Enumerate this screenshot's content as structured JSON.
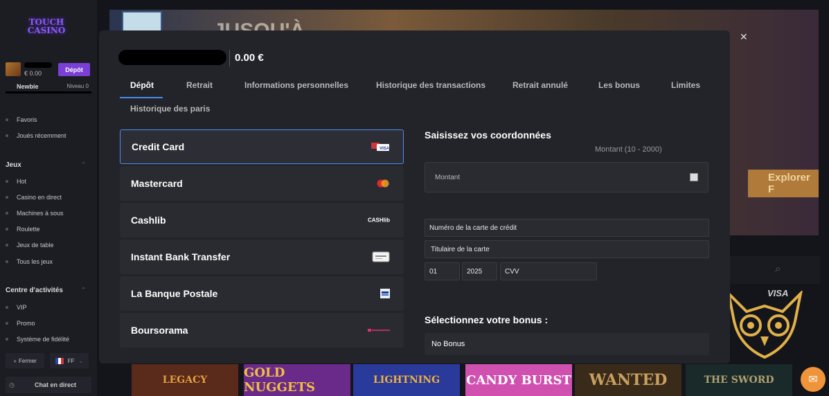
{
  "sidebar": {
    "logo_line1": "TOUCH",
    "logo_line2": "CASINO",
    "balance": "€ 0.00",
    "deposit_label": "Dépôt",
    "level_name": "Newbie",
    "level_label": "Niveau 0",
    "level_progress": 0,
    "items_top": [
      {
        "label": "Favoris"
      },
      {
        "label": "Joués récemment"
      }
    ],
    "jeux_heading": "Jeux",
    "jeux_items": [
      {
        "label": "Hot"
      },
      {
        "label": "Casino en direct"
      },
      {
        "label": "Machines à sous"
      },
      {
        "label": "Roulette"
      },
      {
        "label": "Jeux de table"
      },
      {
        "label": "Tous les jeux"
      }
    ],
    "activity_heading": "Centre d'activités",
    "activity_items": [
      {
        "label": "VIP"
      },
      {
        "label": "Promo"
      },
      {
        "label": "Système de fidélité"
      }
    ],
    "close_label": "Fermer",
    "lang_label": "FF",
    "chat_label": "Chat en direct"
  },
  "background": {
    "banner_text": "JUSQU'À",
    "explorer_label": "Explorer F",
    "visa_text": "VISA",
    "games": [
      "LEGACY",
      "GOLD NUGGETS",
      "LIGHTNING",
      "CANDY BURST",
      "WANTED",
      "THE SWORD"
    ]
  },
  "modal": {
    "balance": "0.00 €",
    "tabs": [
      {
        "label": "Dépôt",
        "active": true
      },
      {
        "label": "Retrait"
      },
      {
        "label": "Informations personnelles"
      },
      {
        "label": "Historique des transactions"
      },
      {
        "label": "Retrait annulé"
      },
      {
        "label": "Les bonus"
      },
      {
        "label": "Limites"
      },
      {
        "label": "Historique des paris"
      }
    ],
    "methods": [
      {
        "label": "Credit Card",
        "logo": "visa-mastercard-logo",
        "selected": true
      },
      {
        "label": "Mastercard",
        "logo": "mastercard-logo"
      },
      {
        "label": "Cashlib",
        "logo": "cashlib-logo",
        "logo_text": "CASHlib"
      },
      {
        "label": "Instant Bank Transfer",
        "logo": "bank-transfer-logo"
      },
      {
        "label": "La Banque Postale",
        "logo": "banque-postale-logo"
      },
      {
        "label": "Boursorama",
        "logo": "boursorama-logo"
      }
    ],
    "form": {
      "title": "Saisissez vos coordonnées",
      "amount_range": "Montant (10 - 2000)",
      "amount_placeholder": "Montant",
      "card_number_placeholder": "Numéro de la carte de crédit",
      "card_holder_placeholder": "Titulaire de la carte",
      "month": "01",
      "year": "2025",
      "cvv_placeholder": "CVV",
      "bonus_title": "Sélectionnez votre bonus :",
      "bonus_value": "No Bonus"
    }
  },
  "colors": {
    "accent": "#4a8ef0",
    "deposit": "#7a3fd6",
    "chat": "#f0943a"
  }
}
